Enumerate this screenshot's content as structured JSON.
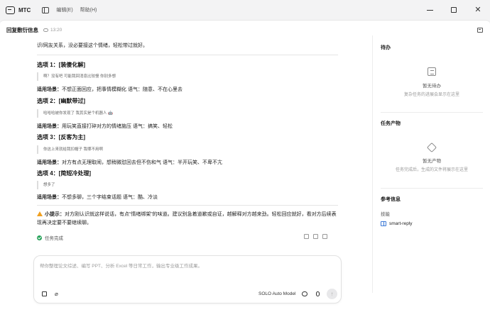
{
  "app": {
    "name": "MTC",
    "menu": [
      "编辑(E)",
      "帮助(H)"
    ]
  },
  "doc": {
    "title": "回复敷衍信息",
    "time": "13:20"
  },
  "chat": {
    "intro": "识/网友关系，没必要接这个情绪，轻松带过就好。",
    "options": [
      {
        "heading": "选项 1：[装傻化解]",
        "quote": "啊？没有吧 可能我回消息比较慢 你别多想",
        "scenario_label": "适用场景：",
        "scenario": "不想正面回应，把事情模糊化 语气：随意、不在心里去"
      },
      {
        "heading": "选项 2：[幽默带过]",
        "quote": "哈哈哈被你发现了 我其实是个机器人 🤖",
        "scenario_label": "适用场景：",
        "scenario": "用玩笑直接打碎对方的情绪施压 语气：搞笑、轻松"
      },
      {
        "heading": "选项 3：[反客为主]",
        "quote": "你这上来就给我扣帽子 我哪不用啊",
        "scenario_label": "适用场景：",
        "scenario": "对方有点无理取闹，想稍微怼回去但不伤和气 语气：半开玩笑、不卑不亢"
      },
      {
        "heading": "选项 4：[简短冷处理]",
        "quote": "想多了",
        "scenario_label": "适用场景：",
        "scenario": "不想多聊，三个字结束话题 语气：酷、冷淡"
      }
    ],
    "tip_label": "小提示：",
    "tip": "对方刚认识就这样说话，有点“情绪绑架”的味道。建议别急着道歉或自证，越解释对方越来劲。轻松回应就好，看对方后续表现再决定要不要继续聊。",
    "status": "任务完成"
  },
  "composer": {
    "placeholder": "帮你整理论文综述、编写 PPT、分析 Excel 等日常工作，输出专业级工作成果。",
    "model": "SOLO Auto Model",
    "send_glyph": "↑"
  },
  "sidebar": {
    "todo": {
      "title": "待办",
      "empty_title": "暂无待办",
      "empty_sub": "复杂任务的进展会显示在这里"
    },
    "outputs": {
      "title": "任务产物",
      "empty_title": "暂无产物",
      "empty_sub": "任务完成后，生成的文件将展示在这里"
    },
    "reference": {
      "title": "参考信息",
      "skills_label": "技能",
      "skill": "smart-reply"
    }
  },
  "icons": {
    "titlebar": [
      "app-logo-icon",
      "sidebar-toggle-icon"
    ],
    "window": [
      "minimize-icon",
      "maximize-icon",
      "close-icon"
    ],
    "composer": [
      "image-icon",
      "paperclip-icon",
      "chat-icon",
      "microphone-icon",
      "send-arrow-icon"
    ],
    "feedback": [
      "thumbs-up-icon",
      "thumbs-down-icon",
      "copy-icon"
    ]
  },
  "colors": {
    "success": "#27a25a",
    "warning": "#f0a020",
    "link": "#3a78d6"
  }
}
